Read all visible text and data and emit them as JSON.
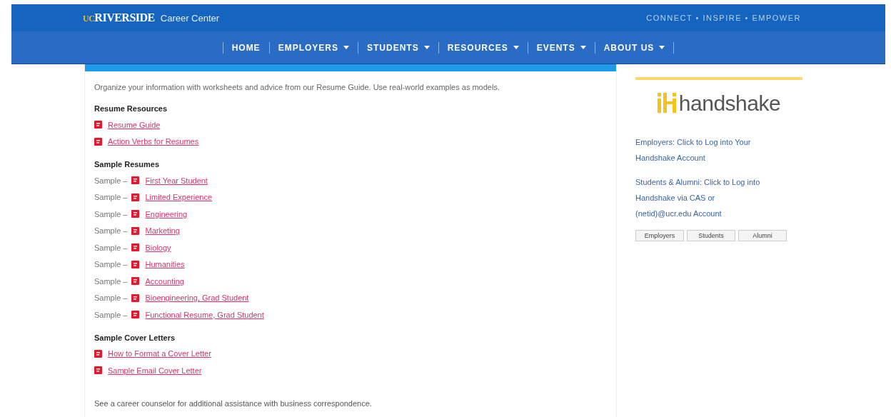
{
  "header": {
    "logo_prefix": "UC",
    "logo_name": "RIVERSIDE",
    "site_name": "Career Center",
    "tagline": "CONNECT • INSPIRE • EMPOWER"
  },
  "nav": [
    {
      "label": "HOME",
      "dropdown": false
    },
    {
      "label": "EMPLOYERS",
      "dropdown": true
    },
    {
      "label": "STUDENTS",
      "dropdown": true
    },
    {
      "label": "RESOURCES",
      "dropdown": true
    },
    {
      "label": "EVENTS",
      "dropdown": true
    },
    {
      "label": "ABOUT US",
      "dropdown": true
    }
  ],
  "main": {
    "intro": "Organize your information with worksheets and advice from our Resume Guide. Use real-world examples as models.",
    "sections": [
      {
        "heading": "Resume Resources",
        "items": [
          {
            "link": "Resume Guide"
          },
          {
            "link": "Action Verbs for Resumes"
          }
        ]
      },
      {
        "heading": "Sample Resumes",
        "items": [
          {
            "prefix": "Sample –",
            "link": "First Year Student"
          },
          {
            "prefix": "Sample –",
            "link": "Limited Experience"
          },
          {
            "prefix": "Sample –",
            "link": "Engineering"
          },
          {
            "prefix": "Sample –",
            "link": "Marketing"
          },
          {
            "prefix": "Sample –",
            "link": "Biology"
          },
          {
            "prefix": "Sample –",
            "link": "Humanities"
          },
          {
            "prefix": "Sample –",
            "link": "Accounting"
          },
          {
            "prefix": "Sample –",
            "link": "Bioengineering, Grad Student"
          },
          {
            "prefix": "Sample –",
            "link": "Functional Resume, Grad Student"
          }
        ]
      },
      {
        "heading": "Sample Cover Letters",
        "items": [
          {
            "link": "How to Format a Cover Letter"
          },
          {
            "link": "Sample Email Cover Letter"
          }
        ]
      }
    ],
    "footer_note": "See a career counselor for additional assistance with business correspondence."
  },
  "sidebar": {
    "logo_text": "handshake",
    "links": [
      "Employers: Click to Log into Your Handshake Account",
      "Students & Alumni: Click to Log into Handshake via CAS or (netid)@ucr.edu Account"
    ],
    "buttons": [
      "Employers",
      "Students",
      "Alumni"
    ]
  }
}
